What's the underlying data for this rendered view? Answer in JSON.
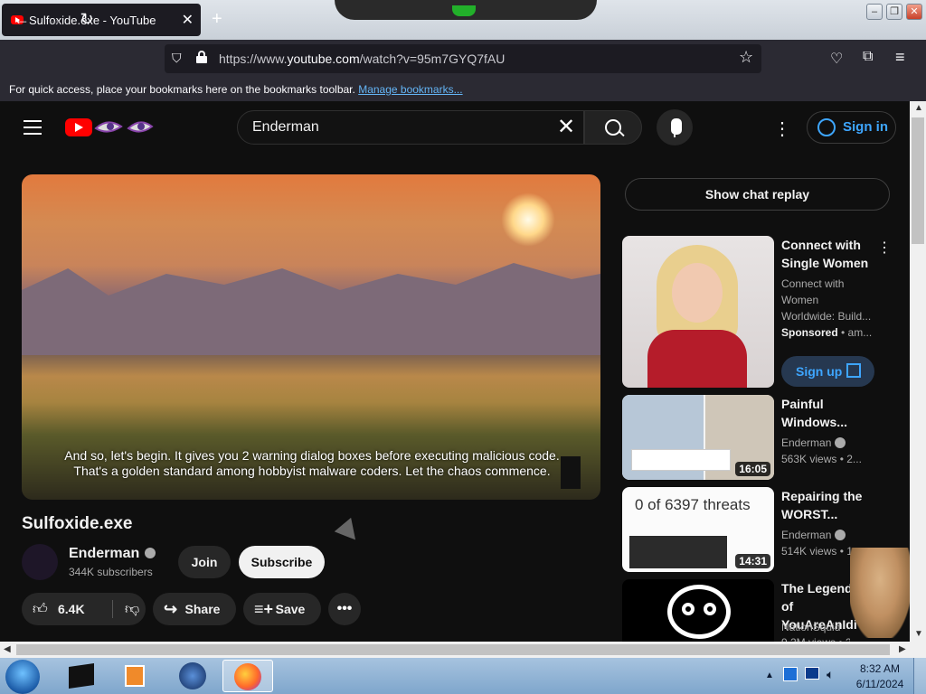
{
  "browser": {
    "tab_title": "Sulfoxide.exe - YouTube",
    "tab_close": "✕",
    "new_tab": "+",
    "url_prefix": "https://www.",
    "url_domain": "youtube.com",
    "url_path": "/watch?v=95m7GYQ7fAU",
    "bookmarks_text": "For quick access, place your bookmarks here on the bookmarks toolbar.",
    "bookmarks_link": "Manage bookmarks..."
  },
  "youtube": {
    "search_value": "Enderman",
    "sign_in": "Sign in",
    "video_title": "Sulfoxide.exe",
    "caption_line1": "And so, let's begin. It gives you 2 warning dialog boxes before executing malicious code.",
    "caption_line2": "That's a golden standard among hobbyist malware coders. Let the chaos commence.",
    "channel_name": "Enderman",
    "subscribers": "344K subscribers",
    "join": "Join",
    "subscribe": "Subscribe",
    "likes": "6.4K",
    "share": "Share",
    "save": "Save",
    "show_chat_replay": "Show chat replay"
  },
  "sidebar": {
    "ad": {
      "title": "Connect with Single Women",
      "description": "Connect with Women Worldwide: Build...",
      "sponsored": "Sponsored",
      "advertiser": "• am...",
      "cta": "Sign up"
    },
    "videos": [
      {
        "title": "Painful Windows...",
        "channel": "Enderman",
        "stats": "563K views  • 2...",
        "duration": "16:05"
      },
      {
        "title": "Repairing the WORST...",
        "channel": "Enderman",
        "stats": "514K views  • 1...",
        "duration": "14:31",
        "thumb_text": "0 of 6397 threats"
      },
      {
        "title": "The Legend of YouAreAnIdiot",
        "channel": "NationSquid",
        "stats": "9.2M views  • 2..."
      }
    ]
  },
  "taskbar": {
    "time": "8:32 AM",
    "date": "6/11/2024"
  },
  "colors": {
    "accent_blue": "#3ea6ff",
    "youtube_red": "#ff0000",
    "background": "#0f0f0f"
  }
}
